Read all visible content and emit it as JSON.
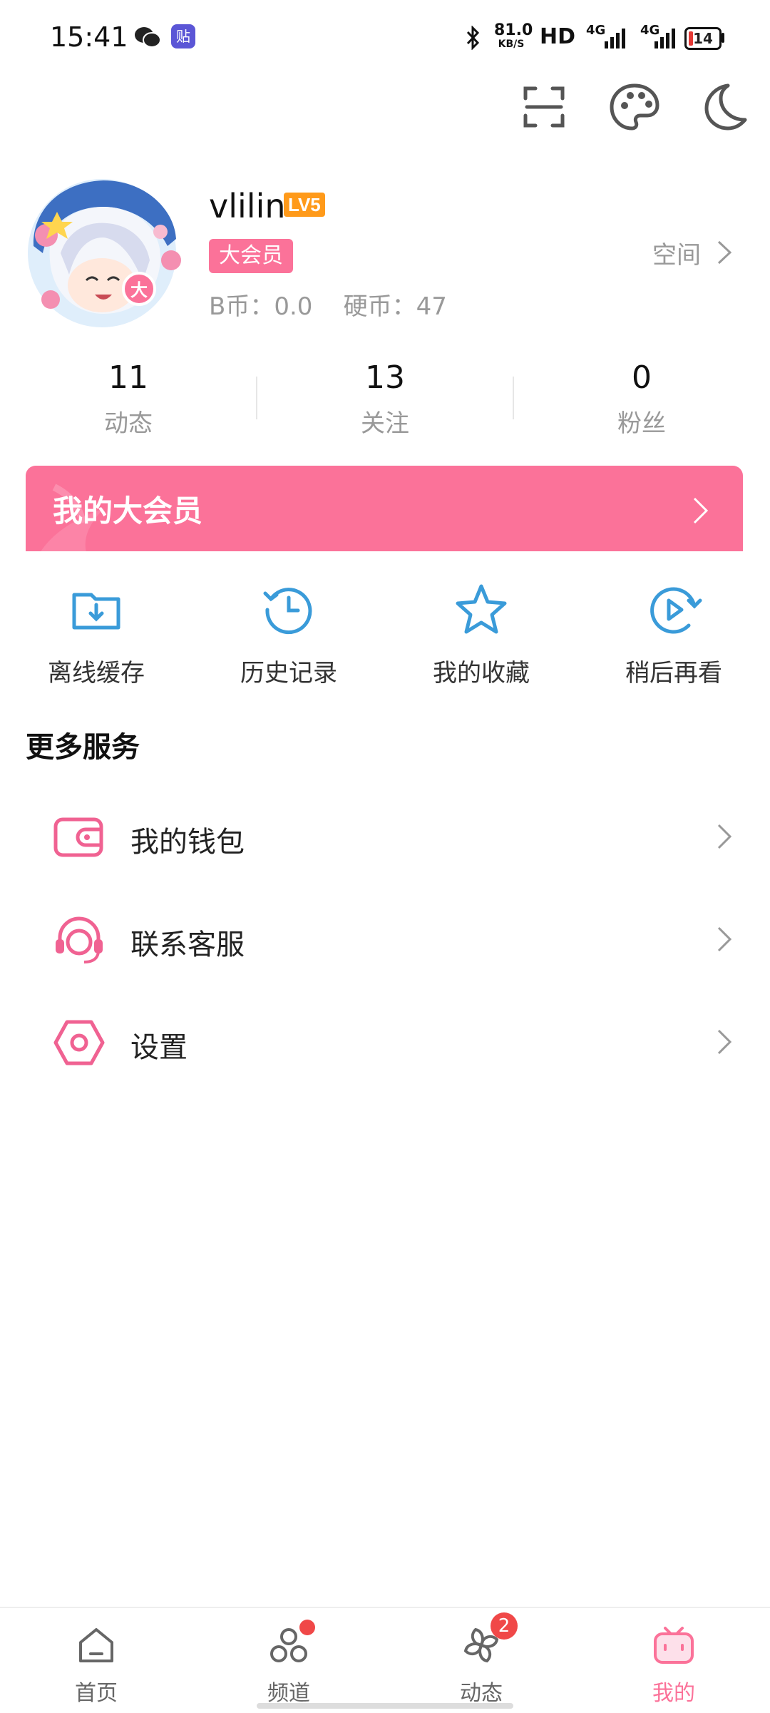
{
  "status_bar": {
    "time": "15:41",
    "net_speed": "81.0",
    "net_unit": "KB/S",
    "hd": "HD",
    "sig1": "4G",
    "sig2": "4G",
    "battery": "14"
  },
  "profile": {
    "username": "vlilin",
    "level": "LV5",
    "vip_badge": "大会员",
    "coins_text": "B币：0.0    硬币：47",
    "space_label": "空间"
  },
  "stats": [
    {
      "value": "11",
      "label": "动态"
    },
    {
      "value": "13",
      "label": "关注"
    },
    {
      "value": "0",
      "label": "粉丝"
    }
  ],
  "vip_banner": {
    "label": "我的大会员"
  },
  "quick_actions": [
    {
      "label": "离线缓存",
      "icon": "download-folder-icon"
    },
    {
      "label": "历史记录",
      "icon": "history-clock-icon"
    },
    {
      "label": "我的收藏",
      "icon": "star-icon"
    },
    {
      "label": "稍后再看",
      "icon": "watch-later-icon"
    }
  ],
  "more_services": {
    "title": "更多服务",
    "items": [
      {
        "label": "我的钱包",
        "icon": "wallet-icon"
      },
      {
        "label": "联系客服",
        "icon": "customer-service-icon"
      },
      {
        "label": "设置",
        "icon": "settings-icon"
      }
    ]
  },
  "bottom_nav": [
    {
      "label": "首页",
      "icon": "home-icon"
    },
    {
      "label": "频道",
      "icon": "channel-icon"
    },
    {
      "label": "动态",
      "icon": "feed-icon",
      "badge": "2"
    },
    {
      "label": "我的",
      "icon": "tv-icon"
    }
  ],
  "colors": {
    "accent": "#fb7299",
    "blue": "#3a9bd9",
    "level": "#ff9a1a"
  }
}
